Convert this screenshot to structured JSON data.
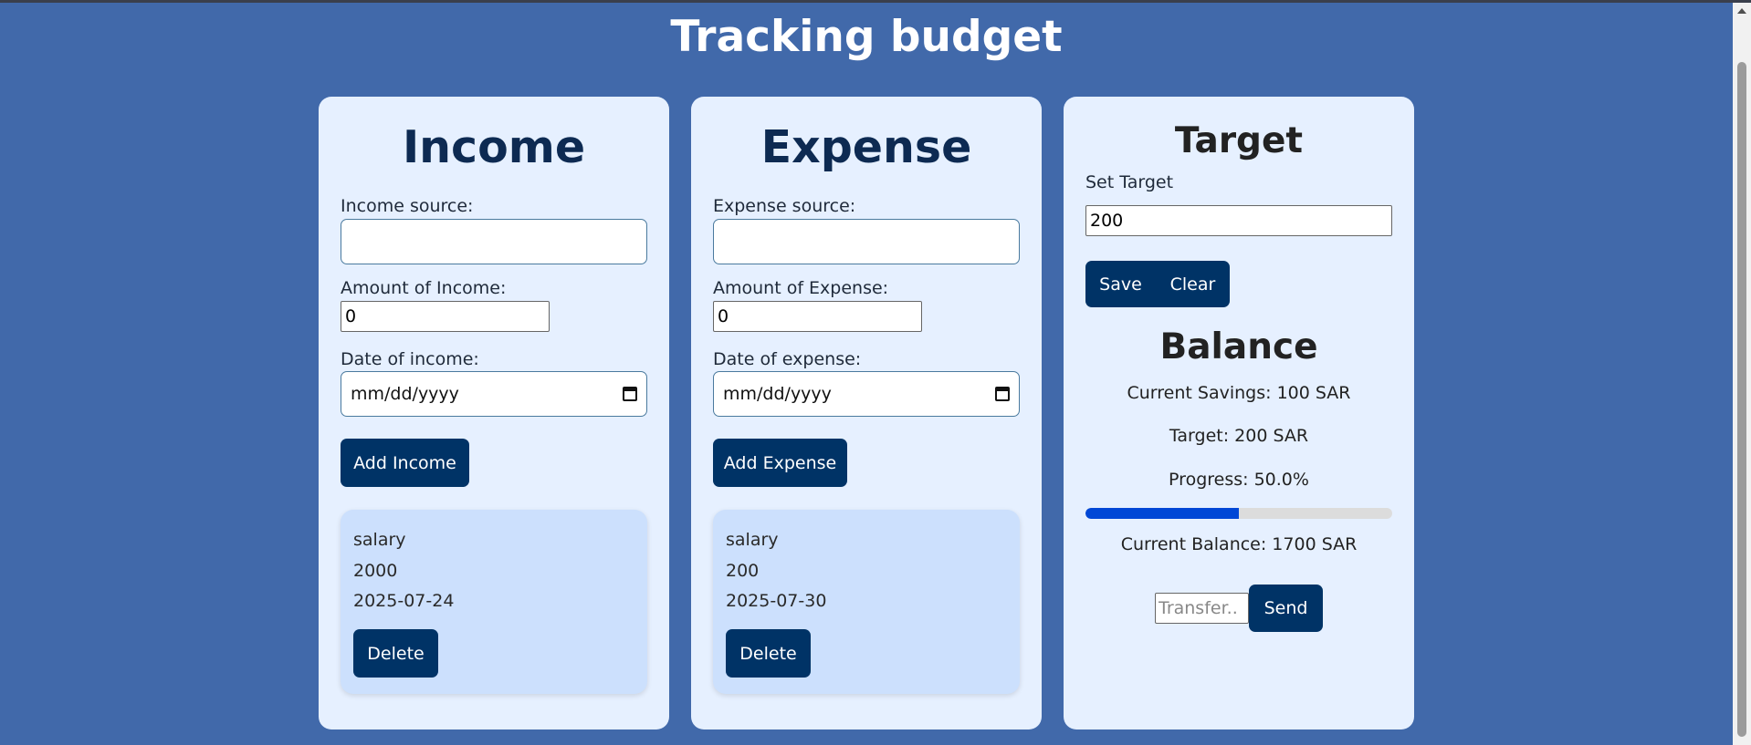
{
  "page": {
    "title": "Tracking budget"
  },
  "income": {
    "heading": "Income",
    "source_label": "Income source:",
    "source_value": "",
    "amount_label": "Amount of Income:",
    "amount_value": "0",
    "date_label": "Date of income:",
    "date_placeholder": "mm/dd/yyyy",
    "add_button": "Add Income",
    "entries": [
      {
        "source": "salary",
        "amount": "2000",
        "date": "2025-07-24",
        "delete_label": "Delete"
      }
    ]
  },
  "expense": {
    "heading": "Expense",
    "source_label": "Expense source:",
    "source_value": "",
    "amount_label": "Amount of Expense:",
    "amount_value": "0",
    "date_label": "Date of expense:",
    "date_placeholder": "mm/dd/yyyy",
    "add_button": "Add Expense",
    "entries": [
      {
        "source": "salary",
        "amount": "200",
        "date": "2025-07-30",
        "delete_label": "Delete"
      }
    ]
  },
  "target": {
    "heading": "Target",
    "set_label": "Set Target",
    "value": "200",
    "save_button": "Save",
    "clear_button": "Clear"
  },
  "balance": {
    "heading": "Balance",
    "current_savings": "Current Savings: 100 SAR",
    "target_text": "Target: 200 SAR",
    "progress_text": "Progress: 50.0%",
    "progress_fraction": 0.5,
    "current_balance": "Current Balance: 1700 SAR",
    "transfer_placeholder": "Transfer..",
    "send_button": "Send"
  },
  "colors": {
    "background": "#4169aa",
    "card": "#e6f0ff",
    "button": "#003366",
    "entry_box": "#cce0fd",
    "progress_fill": "#0047d6"
  },
  "icons": {
    "date_picker": "calendar-icon"
  }
}
